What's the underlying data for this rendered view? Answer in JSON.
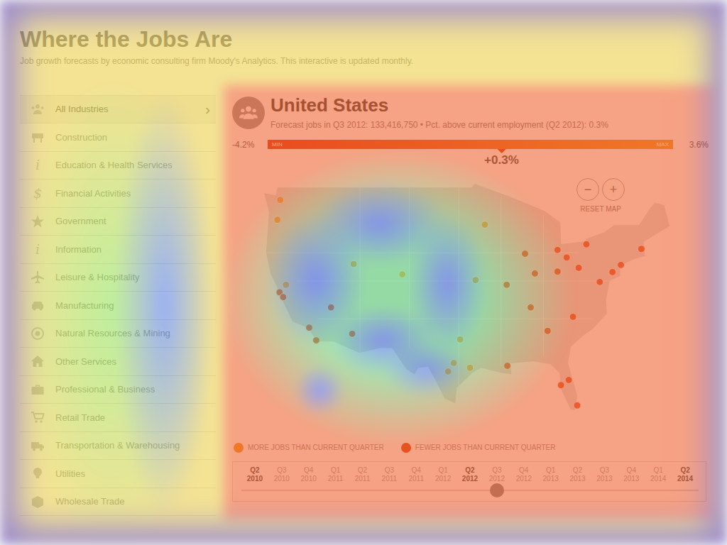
{
  "title": "Where the Jobs Are",
  "subtitle": "Job growth forecasts by economic consulting firm Moody's Analytics. This interactive is updated monthly.",
  "sidebar": {
    "chevron": "›",
    "items": [
      {
        "label": "All Industries",
        "selected": true
      },
      {
        "label": "Construction",
        "selected": false
      },
      {
        "label": "Education & Health Services",
        "selected": false,
        "glyph": "i"
      },
      {
        "label": "Financial Activities",
        "selected": false,
        "glyph": "$"
      },
      {
        "label": "Government",
        "selected": false
      },
      {
        "label": "Information",
        "selected": false,
        "glyph": "i"
      },
      {
        "label": "Leisure & Hospitality",
        "selected": false
      },
      {
        "label": "Manufacturing",
        "selected": false
      },
      {
        "label": "Natural Resources & Mining",
        "selected": false
      },
      {
        "label": "Other Services",
        "selected": false
      },
      {
        "label": "Professional & Business",
        "selected": false
      },
      {
        "label": "Retail Trade",
        "selected": false
      },
      {
        "label": "Transportation & Warehousing",
        "selected": false
      },
      {
        "label": "Utilities",
        "selected": false
      },
      {
        "label": "Wholesale Trade",
        "selected": false
      }
    ]
  },
  "region": {
    "name": "United States",
    "summary": "Forecast jobs in Q3 2012: 133,416,750 • Pct. above current employment (Q2 2012): 0.3%"
  },
  "scale": {
    "min": "-4.2%",
    "min_label": "MIN",
    "max_label": "MAX",
    "max": "3.6%",
    "value": "+0.3%",
    "level": 0.577
  },
  "zoom": {
    "out": "−",
    "in": "+",
    "reset": "RESET MAP"
  },
  "map": {
    "pins": [
      {
        "lat": 47.6,
        "lon": -122.3,
        "color": "#f0a030"
      },
      {
        "lat": 45.5,
        "lon": -122.7,
        "color": "#f0a030"
      },
      {
        "lat": 38.6,
        "lon": -121.5,
        "color": "#f0a030"
      },
      {
        "lat": 37.8,
        "lon": -122.4,
        "color": "#e04a1e"
      },
      {
        "lat": 37.3,
        "lon": -121.9,
        "color": "#e04a1e"
      },
      {
        "lat": 34.05,
        "lon": -118.2,
        "color": "#e04a1e"
      },
      {
        "lat": 32.7,
        "lon": -117.2,
        "color": "#e04a1e"
      },
      {
        "lat": 36.2,
        "lon": -115.1,
        "color": "#e04a1e"
      },
      {
        "lat": 33.4,
        "lon": -112.1,
        "color": "#e04a1e"
      },
      {
        "lat": 40.8,
        "lon": -111.9,
        "color": "#f0a030"
      },
      {
        "lat": 39.7,
        "lon": -105.0,
        "color": "#f0a030"
      },
      {
        "lat": 32.8,
        "lon": -96.8,
        "color": "#f0a030"
      },
      {
        "lat": 29.8,
        "lon": -95.4,
        "color": "#f0a030"
      },
      {
        "lat": 29.4,
        "lon": -98.5,
        "color": "#f0a030"
      },
      {
        "lat": 30.3,
        "lon": -97.7,
        "color": "#f0a030"
      },
      {
        "lat": 44.98,
        "lon": -93.3,
        "color": "#f0a030"
      },
      {
        "lat": 39.1,
        "lon": -94.6,
        "color": "#f0a030"
      },
      {
        "lat": 41.9,
        "lon": -87.6,
        "color": "#e04a1e"
      },
      {
        "lat": 42.3,
        "lon": -83.0,
        "color": "#e04a1e"
      },
      {
        "lat": 38.6,
        "lon": -90.2,
        "color": "#e04a1e"
      },
      {
        "lat": 39.8,
        "lon": -86.2,
        "color": "#e04a1e"
      },
      {
        "lat": 40.0,
        "lon": -83.0,
        "color": "#e04a1e"
      },
      {
        "lat": 41.5,
        "lon": -81.7,
        "color": "#e04a1e"
      },
      {
        "lat": 40.4,
        "lon": -80.0,
        "color": "#e04a1e"
      },
      {
        "lat": 42.9,
        "lon": -78.9,
        "color": "#e04a1e"
      },
      {
        "lat": 36.2,
        "lon": -86.8,
        "color": "#e04a1e"
      },
      {
        "lat": 33.7,
        "lon": -84.4,
        "color": "#e04a1e"
      },
      {
        "lat": 35.2,
        "lon": -80.8,
        "color": "#e04a1e"
      },
      {
        "lat": 30.0,
        "lon": -90.1,
        "color": "#e04a1e"
      },
      {
        "lat": 28.5,
        "lon": -81.4,
        "color": "#e04a1e"
      },
      {
        "lat": 27.95,
        "lon": -82.5,
        "color": "#e04a1e"
      },
      {
        "lat": 25.8,
        "lon": -80.2,
        "color": "#e04a1e"
      },
      {
        "lat": 38.9,
        "lon": -77.0,
        "color": "#e04a1e"
      },
      {
        "lat": 39.95,
        "lon": -75.2,
        "color": "#e04a1e"
      },
      {
        "lat": 40.7,
        "lon": -74.0,
        "color": "#e04a1e"
      },
      {
        "lat": 42.4,
        "lon": -71.1,
        "color": "#e04a1e"
      }
    ]
  },
  "legend": [
    {
      "label": "MORE JOBS THAN CURRENT QUARTER",
      "color": "#f0a030"
    },
    {
      "label": "FEWER JOBS THAN CURRENT QUARTER",
      "color": "#e04a1e"
    }
  ],
  "timeline": {
    "quarters": [
      {
        "q": "Q2",
        "year": "2010",
        "kind": "major",
        "selected": false
      },
      {
        "q": "Q3",
        "year": "2010",
        "kind": "minor",
        "selected": false
      },
      {
        "q": "Q4",
        "year": "2010",
        "kind": "minor",
        "selected": false
      },
      {
        "q": "Q1",
        "year": "2011",
        "kind": "minor",
        "selected": false
      },
      {
        "q": "Q2",
        "year": "2011",
        "kind": "minor",
        "selected": false
      },
      {
        "q": "Q3",
        "year": "2011",
        "kind": "minor",
        "selected": false
      },
      {
        "q": "Q4",
        "year": "2011",
        "kind": "minor",
        "selected": false
      },
      {
        "q": "Q1",
        "year": "2012",
        "kind": "minor",
        "selected": false
      },
      {
        "q": "Q2",
        "year": "2012",
        "kind": "major",
        "selected": false
      },
      {
        "q": "Q3",
        "year": "2012",
        "kind": "minor",
        "selected": true
      },
      {
        "q": "Q4",
        "year": "2012",
        "kind": "minor",
        "selected": false
      },
      {
        "q": "Q1",
        "year": "2013",
        "kind": "minor",
        "selected": false
      },
      {
        "q": "Q2",
        "year": "2013",
        "kind": "minor",
        "selected": false
      },
      {
        "q": "Q3",
        "year": "2013",
        "kind": "minor",
        "selected": false
      },
      {
        "q": "Q4",
        "year": "2013",
        "kind": "minor",
        "selected": false
      },
      {
        "q": "Q1",
        "year": "2014",
        "kind": "minor",
        "selected": false
      },
      {
        "q": "Q2",
        "year": "2014",
        "kind": "major",
        "selected": false
      }
    ]
  }
}
